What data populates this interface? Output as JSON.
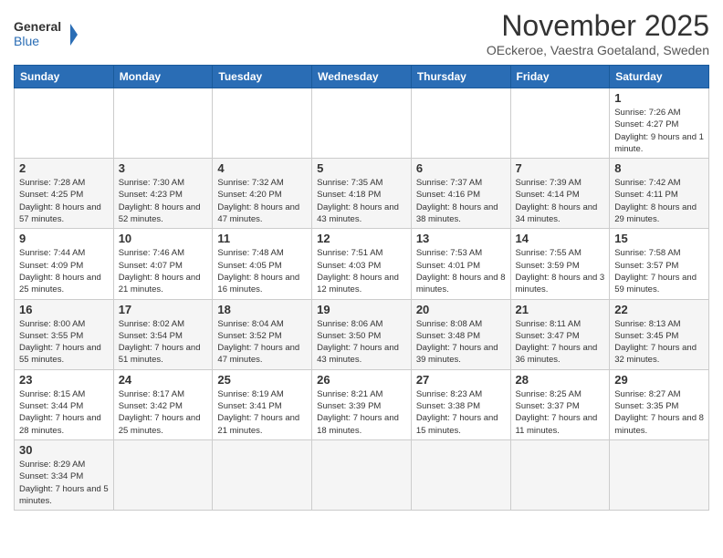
{
  "header": {
    "logo_general": "General",
    "logo_blue": "Blue",
    "month_title": "November 2025",
    "location": "OEckeroe, Vaestra Goetaland, Sweden"
  },
  "weekdays": [
    "Sunday",
    "Monday",
    "Tuesday",
    "Wednesday",
    "Thursday",
    "Friday",
    "Saturday"
  ],
  "weeks": [
    [
      {
        "day": "",
        "info": ""
      },
      {
        "day": "",
        "info": ""
      },
      {
        "day": "",
        "info": ""
      },
      {
        "day": "",
        "info": ""
      },
      {
        "day": "",
        "info": ""
      },
      {
        "day": "",
        "info": ""
      },
      {
        "day": "1",
        "info": "Sunrise: 7:26 AM\nSunset: 4:27 PM\nDaylight: 9 hours and 1 minute."
      }
    ],
    [
      {
        "day": "2",
        "info": "Sunrise: 7:28 AM\nSunset: 4:25 PM\nDaylight: 8 hours and 57 minutes."
      },
      {
        "day": "3",
        "info": "Sunrise: 7:30 AM\nSunset: 4:23 PM\nDaylight: 8 hours and 52 minutes."
      },
      {
        "day": "4",
        "info": "Sunrise: 7:32 AM\nSunset: 4:20 PM\nDaylight: 8 hours and 47 minutes."
      },
      {
        "day": "5",
        "info": "Sunrise: 7:35 AM\nSunset: 4:18 PM\nDaylight: 8 hours and 43 minutes."
      },
      {
        "day": "6",
        "info": "Sunrise: 7:37 AM\nSunset: 4:16 PM\nDaylight: 8 hours and 38 minutes."
      },
      {
        "day": "7",
        "info": "Sunrise: 7:39 AM\nSunset: 4:14 PM\nDaylight: 8 hours and 34 minutes."
      },
      {
        "day": "8",
        "info": "Sunrise: 7:42 AM\nSunset: 4:11 PM\nDaylight: 8 hours and 29 minutes."
      }
    ],
    [
      {
        "day": "9",
        "info": "Sunrise: 7:44 AM\nSunset: 4:09 PM\nDaylight: 8 hours and 25 minutes."
      },
      {
        "day": "10",
        "info": "Sunrise: 7:46 AM\nSunset: 4:07 PM\nDaylight: 8 hours and 21 minutes."
      },
      {
        "day": "11",
        "info": "Sunrise: 7:48 AM\nSunset: 4:05 PM\nDaylight: 8 hours and 16 minutes."
      },
      {
        "day": "12",
        "info": "Sunrise: 7:51 AM\nSunset: 4:03 PM\nDaylight: 8 hours and 12 minutes."
      },
      {
        "day": "13",
        "info": "Sunrise: 7:53 AM\nSunset: 4:01 PM\nDaylight: 8 hours and 8 minutes."
      },
      {
        "day": "14",
        "info": "Sunrise: 7:55 AM\nSunset: 3:59 PM\nDaylight: 8 hours and 3 minutes."
      },
      {
        "day": "15",
        "info": "Sunrise: 7:58 AM\nSunset: 3:57 PM\nDaylight: 7 hours and 59 minutes."
      }
    ],
    [
      {
        "day": "16",
        "info": "Sunrise: 8:00 AM\nSunset: 3:55 PM\nDaylight: 7 hours and 55 minutes."
      },
      {
        "day": "17",
        "info": "Sunrise: 8:02 AM\nSunset: 3:54 PM\nDaylight: 7 hours and 51 minutes."
      },
      {
        "day": "18",
        "info": "Sunrise: 8:04 AM\nSunset: 3:52 PM\nDaylight: 7 hours and 47 minutes."
      },
      {
        "day": "19",
        "info": "Sunrise: 8:06 AM\nSunset: 3:50 PM\nDaylight: 7 hours and 43 minutes."
      },
      {
        "day": "20",
        "info": "Sunrise: 8:08 AM\nSunset: 3:48 PM\nDaylight: 7 hours and 39 minutes."
      },
      {
        "day": "21",
        "info": "Sunrise: 8:11 AM\nSunset: 3:47 PM\nDaylight: 7 hours and 36 minutes."
      },
      {
        "day": "22",
        "info": "Sunrise: 8:13 AM\nSunset: 3:45 PM\nDaylight: 7 hours and 32 minutes."
      }
    ],
    [
      {
        "day": "23",
        "info": "Sunrise: 8:15 AM\nSunset: 3:44 PM\nDaylight: 7 hours and 28 minutes."
      },
      {
        "day": "24",
        "info": "Sunrise: 8:17 AM\nSunset: 3:42 PM\nDaylight: 7 hours and 25 minutes."
      },
      {
        "day": "25",
        "info": "Sunrise: 8:19 AM\nSunset: 3:41 PM\nDaylight: 7 hours and 21 minutes."
      },
      {
        "day": "26",
        "info": "Sunrise: 8:21 AM\nSunset: 3:39 PM\nDaylight: 7 hours and 18 minutes."
      },
      {
        "day": "27",
        "info": "Sunrise: 8:23 AM\nSunset: 3:38 PM\nDaylight: 7 hours and 15 minutes."
      },
      {
        "day": "28",
        "info": "Sunrise: 8:25 AM\nSunset: 3:37 PM\nDaylight: 7 hours and 11 minutes."
      },
      {
        "day": "29",
        "info": "Sunrise: 8:27 AM\nSunset: 3:35 PM\nDaylight: 7 hours and 8 minutes."
      }
    ],
    [
      {
        "day": "30",
        "info": "Sunrise: 8:29 AM\nSunset: 3:34 PM\nDaylight: 7 hours and 5 minutes."
      },
      {
        "day": "",
        "info": ""
      },
      {
        "day": "",
        "info": ""
      },
      {
        "day": "",
        "info": ""
      },
      {
        "day": "",
        "info": ""
      },
      {
        "day": "",
        "info": ""
      },
      {
        "day": "",
        "info": ""
      }
    ]
  ]
}
